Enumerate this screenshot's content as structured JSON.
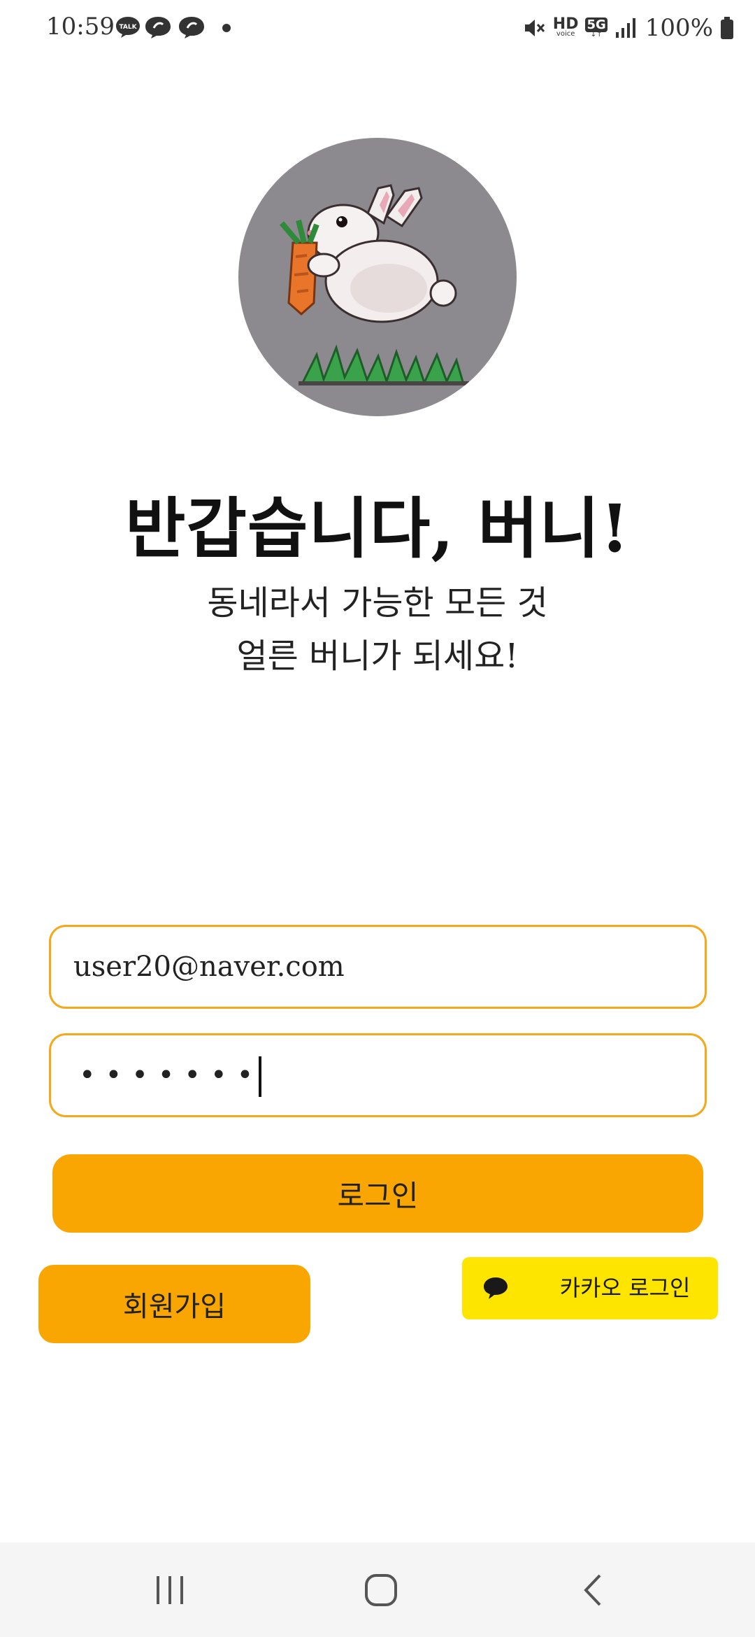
{
  "status_bar": {
    "time": "10:59",
    "talk_badge": "TALK",
    "network_hd": "HD",
    "network_voice": "voice",
    "network_5g": "5G",
    "battery": "100%"
  },
  "welcome": {
    "title": "반갑습니다, 버니!",
    "subtitle_line1": "동네라서 가능한 모든 것",
    "subtitle_line2": "얼른 버니가 되세요!"
  },
  "form": {
    "email_value": "user20@naver.com",
    "password_mask": "•••••••"
  },
  "buttons": {
    "login": "로그인",
    "signup": "회원가입",
    "kakao_login": "카카오 로그인"
  },
  "colors": {
    "accent": "#f9a602",
    "input_border": "#f3a91b",
    "kakao": "#fee500",
    "avatar_bg": "#8d8a8f"
  },
  "icons": {
    "status": [
      "talk-icon",
      "chat-icon",
      "chat-icon",
      "dot-icon",
      "mute-icon",
      "signal-icon",
      "battery-icon"
    ],
    "kakao": "speech-bubble-icon",
    "nav": [
      "recent-apps-icon",
      "home-icon",
      "back-icon"
    ]
  }
}
